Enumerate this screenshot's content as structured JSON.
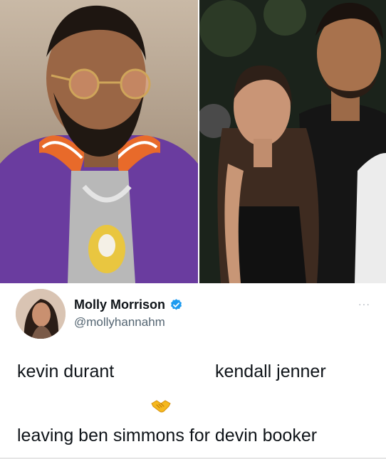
{
  "tweet": {
    "display_name": "Molly Morrison",
    "handle": "@mollyhannahm",
    "verified": true,
    "more_glyph": "···",
    "line_left": "kevin durant",
    "line_right": "kendall jenner",
    "emoji": "handshake-icon",
    "caption": "leaving ben simmons for devin booker"
  },
  "colors": {
    "verified_blue": "#1d9bf0",
    "jacket_purple": "#6a3c9f",
    "text_primary": "#0f1419",
    "text_secondary": "#536471"
  }
}
